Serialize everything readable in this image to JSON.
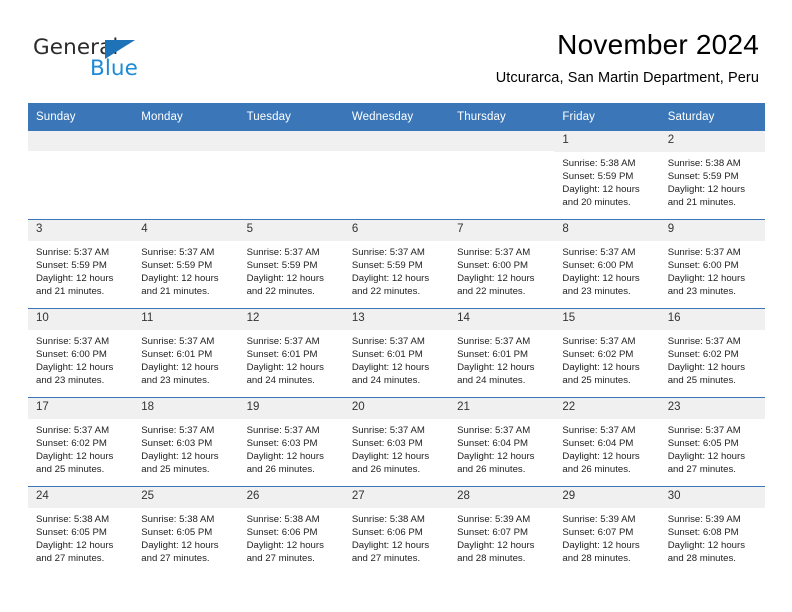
{
  "logo": {
    "word_one": "General",
    "word_two": "Blue",
    "triangle_color": "#1e72b8",
    "blue_color": "#1e8ad6"
  },
  "header": {
    "month_title": "November 2024",
    "location": "Utcurarca, San Martin Department, Peru"
  },
  "theme": {
    "header_bg": "#3b77b8",
    "header_text": "#ffffff",
    "daynum_bg": "#f0f0f0",
    "rule_color": "#3b77b8"
  },
  "calendar": {
    "weekday_headers": [
      "Sunday",
      "Monday",
      "Tuesday",
      "Wednesday",
      "Thursday",
      "Friday",
      "Saturday"
    ],
    "weeks": [
      [
        {
          "day": "",
          "empty": true
        },
        {
          "day": "",
          "empty": true
        },
        {
          "day": "",
          "empty": true
        },
        {
          "day": "",
          "empty": true
        },
        {
          "day": "",
          "empty": true
        },
        {
          "day": "1",
          "sunrise": "Sunrise: 5:38 AM",
          "sunset": "Sunset: 5:59 PM",
          "daylight": "Daylight: 12 hours and 20 minutes."
        },
        {
          "day": "2",
          "sunrise": "Sunrise: 5:38 AM",
          "sunset": "Sunset: 5:59 PM",
          "daylight": "Daylight: 12 hours and 21 minutes."
        }
      ],
      [
        {
          "day": "3",
          "sunrise": "Sunrise: 5:37 AM",
          "sunset": "Sunset: 5:59 PM",
          "daylight": "Daylight: 12 hours and 21 minutes."
        },
        {
          "day": "4",
          "sunrise": "Sunrise: 5:37 AM",
          "sunset": "Sunset: 5:59 PM",
          "daylight": "Daylight: 12 hours and 21 minutes."
        },
        {
          "day": "5",
          "sunrise": "Sunrise: 5:37 AM",
          "sunset": "Sunset: 5:59 PM",
          "daylight": "Daylight: 12 hours and 22 minutes."
        },
        {
          "day": "6",
          "sunrise": "Sunrise: 5:37 AM",
          "sunset": "Sunset: 5:59 PM",
          "daylight": "Daylight: 12 hours and 22 minutes."
        },
        {
          "day": "7",
          "sunrise": "Sunrise: 5:37 AM",
          "sunset": "Sunset: 6:00 PM",
          "daylight": "Daylight: 12 hours and 22 minutes."
        },
        {
          "day": "8",
          "sunrise": "Sunrise: 5:37 AM",
          "sunset": "Sunset: 6:00 PM",
          "daylight": "Daylight: 12 hours and 23 minutes."
        },
        {
          "day": "9",
          "sunrise": "Sunrise: 5:37 AM",
          "sunset": "Sunset: 6:00 PM",
          "daylight": "Daylight: 12 hours and 23 minutes."
        }
      ],
      [
        {
          "day": "10",
          "sunrise": "Sunrise: 5:37 AM",
          "sunset": "Sunset: 6:00 PM",
          "daylight": "Daylight: 12 hours and 23 minutes."
        },
        {
          "day": "11",
          "sunrise": "Sunrise: 5:37 AM",
          "sunset": "Sunset: 6:01 PM",
          "daylight": "Daylight: 12 hours and 23 minutes."
        },
        {
          "day": "12",
          "sunrise": "Sunrise: 5:37 AM",
          "sunset": "Sunset: 6:01 PM",
          "daylight": "Daylight: 12 hours and 24 minutes."
        },
        {
          "day": "13",
          "sunrise": "Sunrise: 5:37 AM",
          "sunset": "Sunset: 6:01 PM",
          "daylight": "Daylight: 12 hours and 24 minutes."
        },
        {
          "day": "14",
          "sunrise": "Sunrise: 5:37 AM",
          "sunset": "Sunset: 6:01 PM",
          "daylight": "Daylight: 12 hours and 24 minutes."
        },
        {
          "day": "15",
          "sunrise": "Sunrise: 5:37 AM",
          "sunset": "Sunset: 6:02 PM",
          "daylight": "Daylight: 12 hours and 25 minutes."
        },
        {
          "day": "16",
          "sunrise": "Sunrise: 5:37 AM",
          "sunset": "Sunset: 6:02 PM",
          "daylight": "Daylight: 12 hours and 25 minutes."
        }
      ],
      [
        {
          "day": "17",
          "sunrise": "Sunrise: 5:37 AM",
          "sunset": "Sunset: 6:02 PM",
          "daylight": "Daylight: 12 hours and 25 minutes."
        },
        {
          "day": "18",
          "sunrise": "Sunrise: 5:37 AM",
          "sunset": "Sunset: 6:03 PM",
          "daylight": "Daylight: 12 hours and 25 minutes."
        },
        {
          "day": "19",
          "sunrise": "Sunrise: 5:37 AM",
          "sunset": "Sunset: 6:03 PM",
          "daylight": "Daylight: 12 hours and 26 minutes."
        },
        {
          "day": "20",
          "sunrise": "Sunrise: 5:37 AM",
          "sunset": "Sunset: 6:03 PM",
          "daylight": "Daylight: 12 hours and 26 minutes."
        },
        {
          "day": "21",
          "sunrise": "Sunrise: 5:37 AM",
          "sunset": "Sunset: 6:04 PM",
          "daylight": "Daylight: 12 hours and 26 minutes."
        },
        {
          "day": "22",
          "sunrise": "Sunrise: 5:37 AM",
          "sunset": "Sunset: 6:04 PM",
          "daylight": "Daylight: 12 hours and 26 minutes."
        },
        {
          "day": "23",
          "sunrise": "Sunrise: 5:37 AM",
          "sunset": "Sunset: 6:05 PM",
          "daylight": "Daylight: 12 hours and 27 minutes."
        }
      ],
      [
        {
          "day": "24",
          "sunrise": "Sunrise: 5:38 AM",
          "sunset": "Sunset: 6:05 PM",
          "daylight": "Daylight: 12 hours and 27 minutes."
        },
        {
          "day": "25",
          "sunrise": "Sunrise: 5:38 AM",
          "sunset": "Sunset: 6:05 PM",
          "daylight": "Daylight: 12 hours and 27 minutes."
        },
        {
          "day": "26",
          "sunrise": "Sunrise: 5:38 AM",
          "sunset": "Sunset: 6:06 PM",
          "daylight": "Daylight: 12 hours and 27 minutes."
        },
        {
          "day": "27",
          "sunrise": "Sunrise: 5:38 AM",
          "sunset": "Sunset: 6:06 PM",
          "daylight": "Daylight: 12 hours and 27 minutes."
        },
        {
          "day": "28",
          "sunrise": "Sunrise: 5:39 AM",
          "sunset": "Sunset: 6:07 PM",
          "daylight": "Daylight: 12 hours and 28 minutes."
        },
        {
          "day": "29",
          "sunrise": "Sunrise: 5:39 AM",
          "sunset": "Sunset: 6:07 PM",
          "daylight": "Daylight: 12 hours and 28 minutes."
        },
        {
          "day": "30",
          "sunrise": "Sunrise: 5:39 AM",
          "sunset": "Sunset: 6:08 PM",
          "daylight": "Daylight: 12 hours and 28 minutes."
        }
      ]
    ]
  }
}
